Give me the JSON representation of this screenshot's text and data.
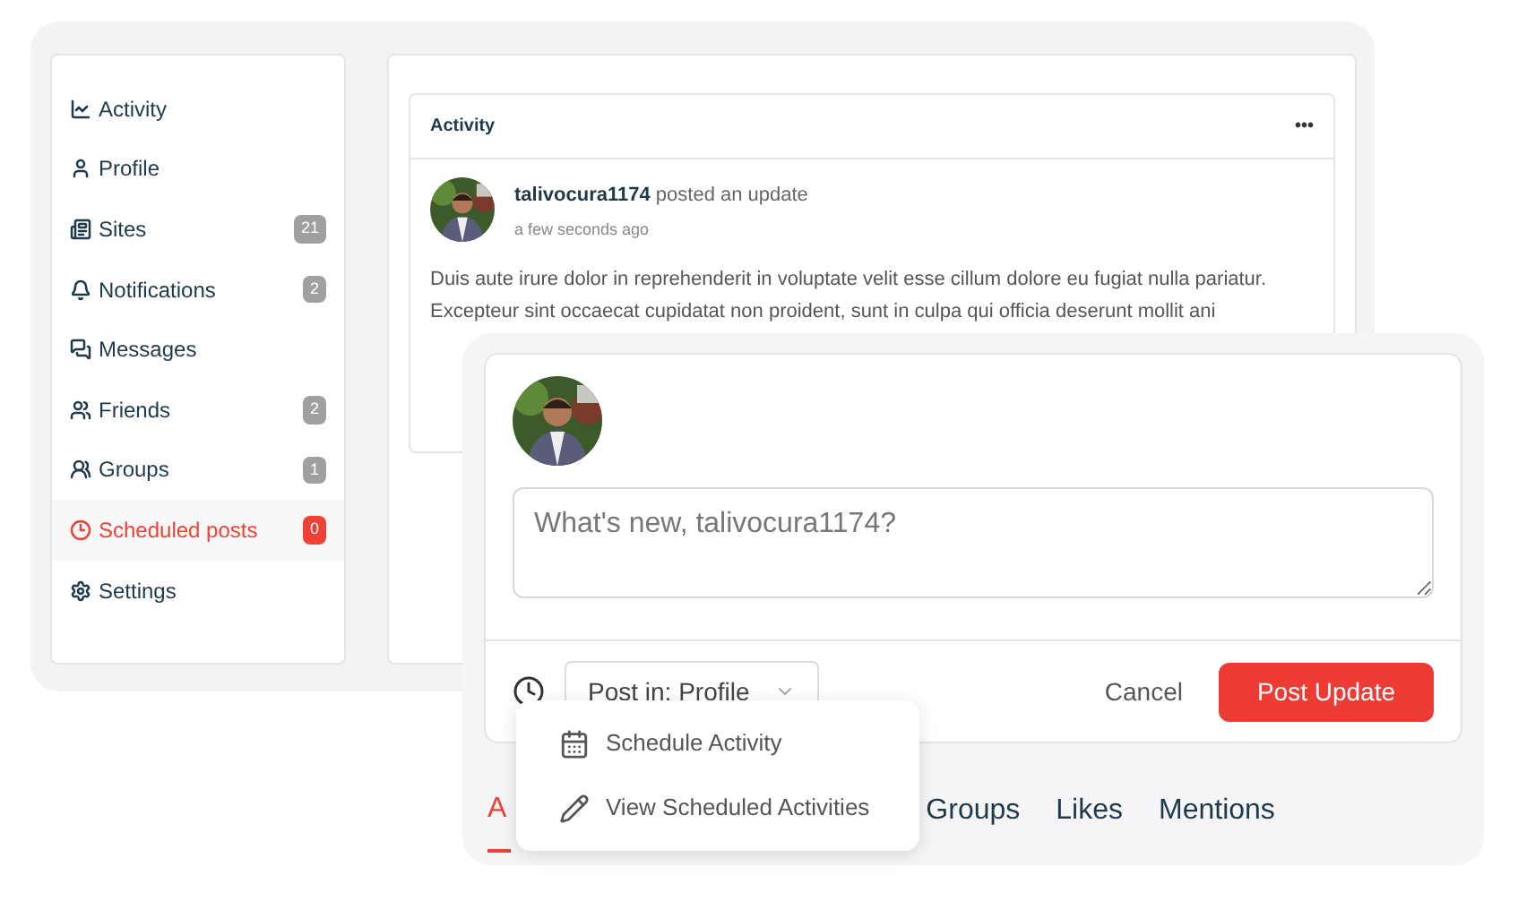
{
  "sidebar": {
    "items": [
      {
        "kind": "activity",
        "label": "Activity",
        "selected": false
      },
      {
        "kind": "profile",
        "label": "Profile",
        "selected": false
      },
      {
        "kind": "sites",
        "label": "Sites",
        "count": "21",
        "selected": false
      },
      {
        "kind": "notifications",
        "label": "Notifications",
        "count": "2",
        "selected": false
      },
      {
        "kind": "messages",
        "label": "Messages",
        "selected": false
      },
      {
        "kind": "friends",
        "label": "Friends",
        "count": "2",
        "selected": false
      },
      {
        "kind": "groups",
        "label": "Groups",
        "count": "1",
        "selected": false
      },
      {
        "kind": "scheduled",
        "label": "Scheduled posts",
        "count": "0",
        "selected": true
      },
      {
        "kind": "settings",
        "label": "Settings",
        "selected": false
      }
    ]
  },
  "activity_card": {
    "title": "Activity",
    "more": "•••",
    "post": {
      "author": "talivocura1174",
      "action": "posted an update",
      "time": "a few seconds ago",
      "body": "Duis aute irure dolor in reprehenderit in voluptate velit esse cillum dolore eu fugiat nulla pariatur. Excepteur sint occaecat cupidatat non proident, sunt in culpa qui officia deserunt mollit ani"
    }
  },
  "composer": {
    "placeholder": "What's new, talivocura1174?",
    "post_in": "Post in: Profile",
    "cancel": "Cancel",
    "submit": "Post Update",
    "menu": [
      {
        "kind": "calendar",
        "label": "Schedule Activity"
      },
      {
        "kind": "pencil",
        "label": "View Scheduled Activities"
      }
    ],
    "tabs": [
      {
        "label": "A",
        "selected": true
      },
      {
        "label": "Groups",
        "selected": false
      },
      {
        "label": "Likes",
        "selected": false
      },
      {
        "label": "Mentions",
        "selected": false
      }
    ]
  }
}
